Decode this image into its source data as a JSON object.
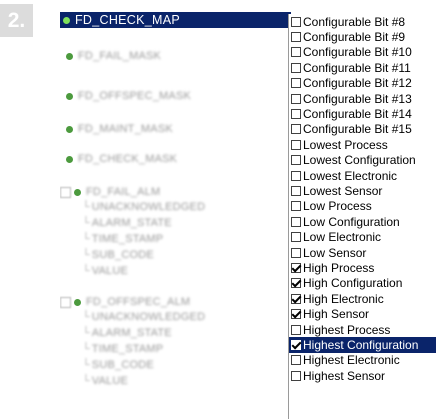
{
  "step": "2.",
  "tree": {
    "selected": "FD_CHECK_MAP",
    "items": [
      {
        "label": "FD_FAIL_MASK"
      },
      {
        "label": "FD_OFFSPEC_MASK"
      },
      {
        "label": "FD_MAINT_MASK"
      },
      {
        "label": "FD_CHECK_MASK"
      }
    ],
    "group1": {
      "label": "FD_FAIL_ALM",
      "children": [
        "UNACKNOWLEDGED",
        "ALARM_STATE",
        "TIME_STAMP",
        "SUB_CODE",
        "VALUE"
      ]
    },
    "group2": {
      "label": "FD_OFFSPEC_ALM",
      "children": [
        "UNACKNOWLEDGED",
        "ALARM_STATE",
        "TIME_STAMP",
        "SUB_CODE",
        "VALUE"
      ]
    }
  },
  "checklist": [
    {
      "label": "Configurable Bit #8",
      "checked": false
    },
    {
      "label": "Configurable Bit #9",
      "checked": false
    },
    {
      "label": "Configurable Bit #10",
      "checked": false
    },
    {
      "label": "Configurable Bit #11",
      "checked": false
    },
    {
      "label": "Configurable Bit #12",
      "checked": false
    },
    {
      "label": "Configurable Bit #13",
      "checked": false
    },
    {
      "label": "Configurable Bit #14",
      "checked": false
    },
    {
      "label": "Configurable Bit #15",
      "checked": false
    },
    {
      "label": "Lowest Process",
      "checked": false
    },
    {
      "label": "Lowest Configuration",
      "checked": false
    },
    {
      "label": "Lowest Electronic",
      "checked": false
    },
    {
      "label": "Lowest Sensor",
      "checked": false
    },
    {
      "label": "Low Process",
      "checked": false
    },
    {
      "label": "Low Configuration",
      "checked": false
    },
    {
      "label": "Low Electronic",
      "checked": false
    },
    {
      "label": "Low Sensor",
      "checked": false
    },
    {
      "label": "High Process",
      "checked": true
    },
    {
      "label": "High Configuration",
      "checked": true
    },
    {
      "label": "High Electronic",
      "checked": true
    },
    {
      "label": "High Sensor",
      "checked": true
    },
    {
      "label": "Highest Process",
      "checked": false
    },
    {
      "label": "Highest Configuration",
      "checked": true,
      "highlighted": true
    },
    {
      "label": "Highest Electronic",
      "checked": false
    },
    {
      "label": "Highest Sensor",
      "checked": false
    }
  ],
  "colors": {
    "selection": "#0a246a",
    "tree_icon": "#4c9a3e"
  }
}
